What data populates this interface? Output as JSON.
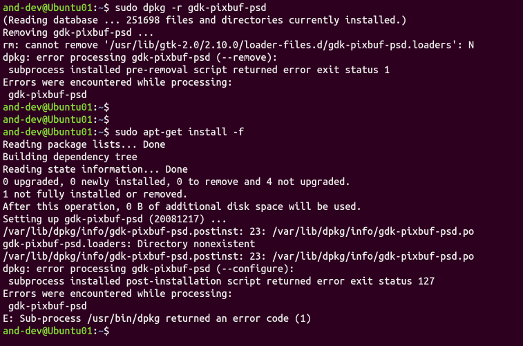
{
  "prompt": {
    "user_host": "and-dev@Ubuntu01",
    "path": "~",
    "sep": ":",
    "end": "$"
  },
  "cmds": {
    "c1": " sudo dpkg -r gdk-pixbuf-psd",
    "c2": " ",
    "c3": " ",
    "c4": " sudo apt-get install -f",
    "c5": " "
  },
  "out": {
    "o1": "(Reading database ... 251698 files and directories currently installed.)",
    "o2": "Removing gdk-pixbuf-psd ...",
    "o3": "rm: cannot remove '/usr/lib/gtk-2.0/2.10.0/loader-files.d/gdk-pixbuf-psd.loaders': N",
    "o4": "dpkg: error processing gdk-pixbuf-psd (--remove):",
    "o5": " subprocess installed pre-removal script returned error exit status 1",
    "o6": "Errors were encountered while processing:",
    "o7": " gdk-pixbuf-psd",
    "o8": "Reading package lists... Done",
    "o9": "Building dependency tree",
    "o10": "Reading state information... Done",
    "o11": "0 upgraded, 0 newly installed, 0 to remove and 4 not upgraded.",
    "o12": "1 not fully installed or removed.",
    "o13": "After this operation, 0 B of additional disk space will be used.",
    "o14": "Setting up gdk-pixbuf-psd (20081217) ...",
    "o15": "/var/lib/dpkg/info/gdk-pixbuf-psd.postinst: 23: /var/lib/dpkg/info/gdk-pixbuf-psd.po",
    "o16": "gdk-pixbuf-psd.loaders: Directory nonexistent",
    "o17": "/var/lib/dpkg/info/gdk-pixbuf-psd.postinst: 23: /var/lib/dpkg/info/gdk-pixbuf-psd.po",
    "o18": "dpkg: error processing gdk-pixbuf-psd (--configure):",
    "o19": " subprocess installed post-installation script returned error exit status 127",
    "o20": "Errors were encountered while processing:",
    "o21": " gdk-pixbuf-psd",
    "o22": "E: Sub-process /usr/bin/dpkg returned an error code (1)"
  }
}
